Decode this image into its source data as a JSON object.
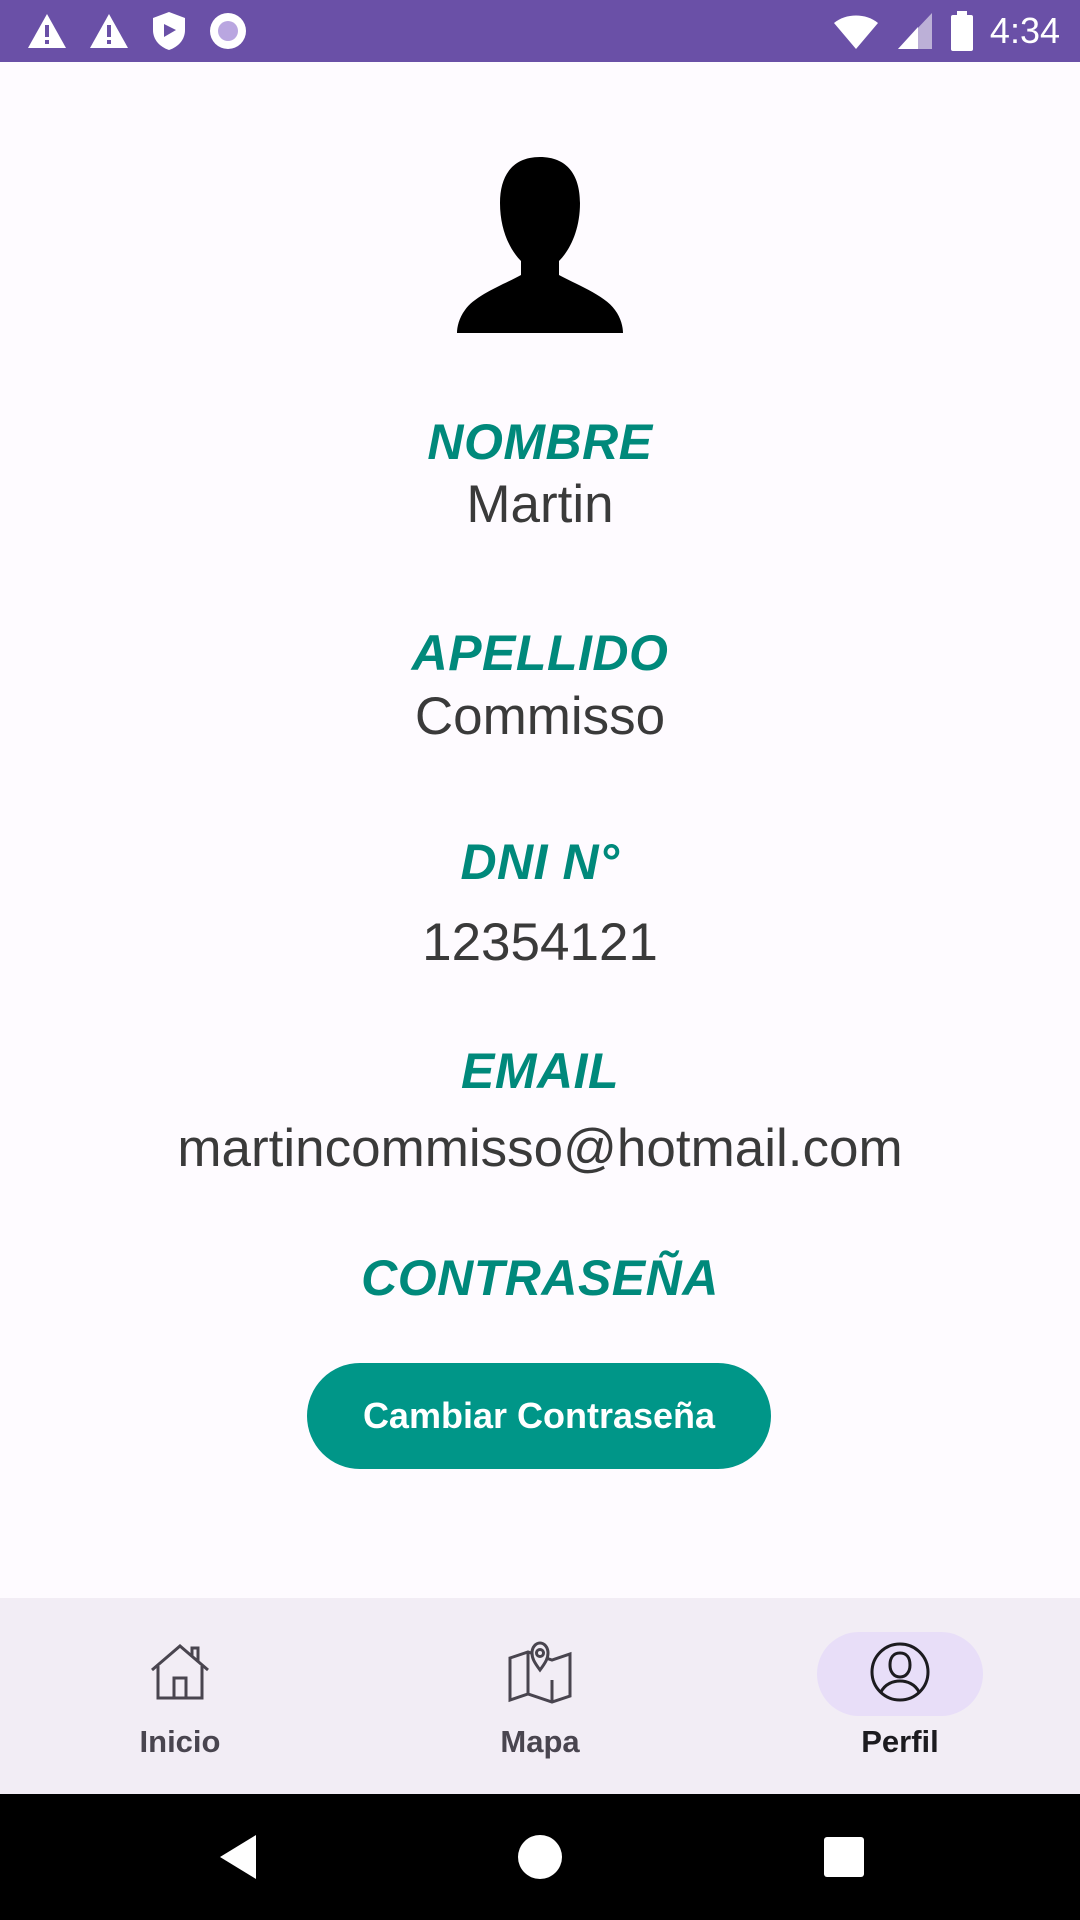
{
  "status_bar": {
    "time": "4:34",
    "icons_left": [
      "warning-icon",
      "warning-icon",
      "shield-icon",
      "record-icon"
    ],
    "icons_right": [
      "wifi-icon",
      "signal-icon",
      "battery-icon"
    ],
    "background": "#6a50a7"
  },
  "profile": {
    "avatar_icon": "person-silhouette-icon",
    "fields": [
      {
        "label": "NOMBRE",
        "value": "Martin"
      },
      {
        "label": "APELLIDO",
        "value": "Commisso"
      },
      {
        "label": "DNI N°",
        "value": "12354121"
      },
      {
        "label": "EMAIL",
        "value": "martincommisso@hotmail.com"
      },
      {
        "label": "CONTRASEÑA",
        "value": ""
      }
    ],
    "change_password_label": "Cambiar Contraseña",
    "label_color": "#00897b",
    "button_color": "#009688"
  },
  "bottom_nav": {
    "items": [
      {
        "label": "Inicio",
        "icon": "home-icon",
        "active": false
      },
      {
        "label": "Mapa",
        "icon": "map-icon",
        "active": false
      },
      {
        "label": "Perfil",
        "icon": "profile-icon",
        "active": true
      }
    ]
  },
  "system_nav": {
    "buttons": [
      "back-icon",
      "home-circle-icon",
      "recents-icon"
    ]
  }
}
